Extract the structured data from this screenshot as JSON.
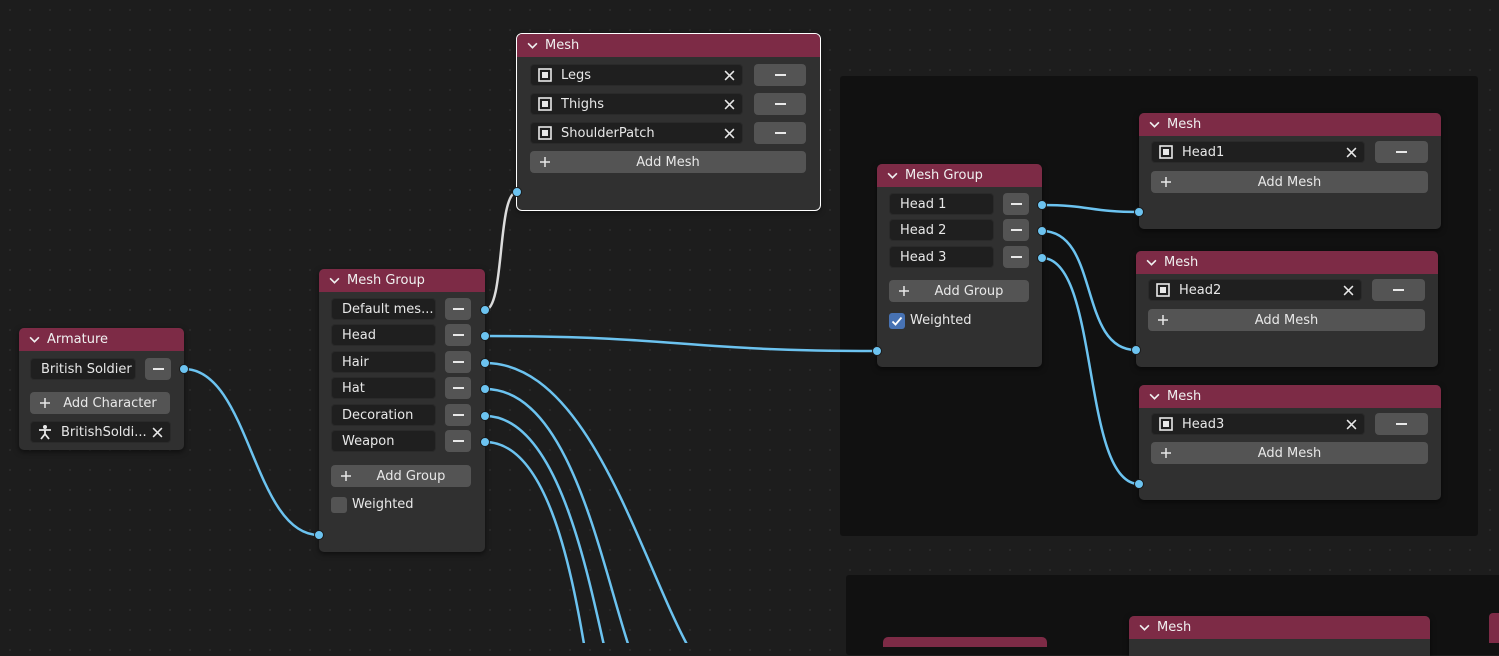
{
  "colors": {
    "wire": "#6cc3f0",
    "header": "#7d2b46",
    "selected_wire": "#e0e0e0"
  },
  "armature": {
    "title": "Armature",
    "character_name": "British Soldier",
    "add_label": "Add Character",
    "object": "BritishSoldi..."
  },
  "mesh_group_left": {
    "title": "Mesh Group",
    "items": [
      "Default mes...",
      "Head",
      "Hair",
      "Hat",
      "Decoration",
      "Weapon"
    ],
    "add_label": "Add Group",
    "weighted_label": "Weighted",
    "weighted": false
  },
  "mesh_top": {
    "title": "Mesh",
    "items": [
      "Legs",
      "Thighs",
      "ShoulderPatch"
    ],
    "add_label": "Add Mesh"
  },
  "mesh_group_right": {
    "title": "Mesh Group",
    "items": [
      "Head 1",
      "Head 2",
      "Head 3"
    ],
    "add_label": "Add Group",
    "weighted_label": "Weighted",
    "weighted": true
  },
  "mesh_head1": {
    "title": "Mesh",
    "items": [
      "Head1"
    ],
    "add_label": "Add Mesh"
  },
  "mesh_head2": {
    "title": "Mesh",
    "items": [
      "Head2"
    ],
    "add_label": "Add Mesh"
  },
  "mesh_head3": {
    "title": "Mesh",
    "items": [
      "Head3"
    ],
    "add_label": "Add Mesh"
  },
  "mesh_bottom": {
    "title": "Mesh"
  }
}
